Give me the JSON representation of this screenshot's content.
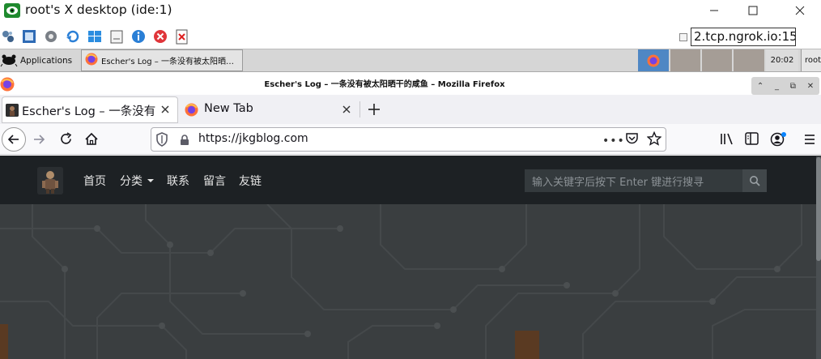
{
  "vnc": {
    "title": "root's X desktop (ide:1)",
    "address": "2.tcp.ngrok.io:15",
    "toolbar_icons": [
      "options-icon",
      "fullscreen-icon",
      "settings-icon",
      "refresh-icon",
      "windows-key-icon",
      "clipboard-icon",
      "info-icon",
      "disconnect-icon",
      "close-session-icon"
    ]
  },
  "taskbar": {
    "applications_label": "Applications",
    "firefox_task_label": "Escher's Log – 一条没有被太阳晒…",
    "clock": "20:02",
    "user_label": "root"
  },
  "firefox": {
    "window_title": "Escher's Log – 一条没有被太阳晒干的咸鱼 – Mozilla Firefox",
    "tabs": [
      {
        "label": "Escher's Log – 一条没有被"
      },
      {
        "label": "New Tab"
      }
    ],
    "url": "https://jkgblog.com"
  },
  "site": {
    "nav": [
      {
        "label": "首页"
      },
      {
        "label": "分类"
      },
      {
        "label": "联系"
      },
      {
        "label": "留言"
      },
      {
        "label": "友链"
      }
    ],
    "search_placeholder": "输入关键字后按下 Enter 键进行搜寻"
  },
  "colors": {
    "header_bg": "#1d2124",
    "hero_bg": "#3a3e40",
    "accent_blue": "#0a84ff"
  }
}
